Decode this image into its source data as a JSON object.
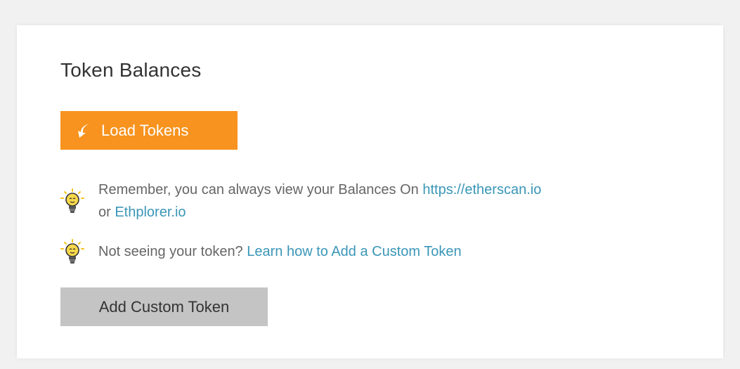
{
  "panel": {
    "title": "Token Balances",
    "load_button": {
      "label": "Load Tokens",
      "icon": "arrow-down-left-icon"
    },
    "tips": [
      {
        "icon": "lightbulb-icon",
        "text": "Remember, you can always view your Balances On ",
        "link1": "https://etherscan.io",
        "middle": " or ",
        "link2": "Ethplorer.io"
      },
      {
        "icon": "lightbulb-icon",
        "text": "Not seeing your token? ",
        "link": "Learn how to Add a Custom Token"
      }
    ],
    "add_button": {
      "label": "Add Custom Token"
    }
  },
  "colors": {
    "background": "#f1f1f1",
    "card": "#ffffff",
    "load_button": "#f7931e",
    "add_button": "#c4c4c4",
    "link": "#3a96b8",
    "text": "#666666",
    "title": "#333333"
  }
}
